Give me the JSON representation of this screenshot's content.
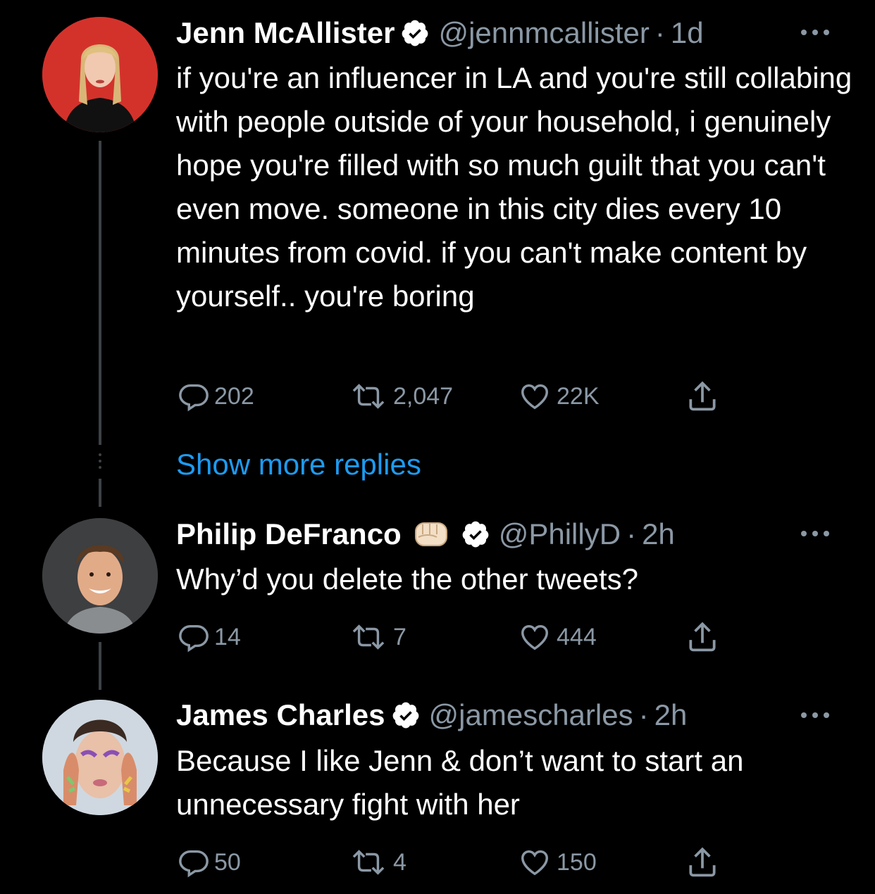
{
  "tweets": [
    {
      "name": "Jenn McAllister",
      "handle": "@jennmcallister",
      "sep": "·",
      "time": "1d",
      "text": "if you're an influencer in LA and you're still collabing with people outside of your household, i genuinely hope you're filled with so much guilt that you can't even move. someone in this city dies every 10 minutes from covid. if you can't make content by yourself.. you're boring",
      "replies": "202",
      "retweets": "2,047",
      "likes": "22K"
    },
    {
      "name": "Philip DeFranco",
      "handle": "@PhillyD",
      "sep": "·",
      "time": "2h",
      "text": "Why’d you delete the other tweets?",
      "replies": "14",
      "retweets": "7",
      "likes": "444"
    },
    {
      "name": "James Charles",
      "handle": "@jamescharles",
      "sep": "·",
      "time": "2h",
      "text": "Because I like Jenn & don’t want to start an unnecessary fight with her",
      "replies": "50",
      "retweets": "4",
      "likes": "150"
    }
  ],
  "show_more": "Show more replies",
  "icons": [
    "verified-icon",
    "more-icon",
    "reply-icon",
    "retweet-icon",
    "like-icon",
    "share-icon",
    "fist-emoji-icon"
  ],
  "colors": {
    "background": "#000000",
    "secondary": "#8b98a5",
    "link": "#1d9bf0",
    "verified": "#ffffff"
  }
}
